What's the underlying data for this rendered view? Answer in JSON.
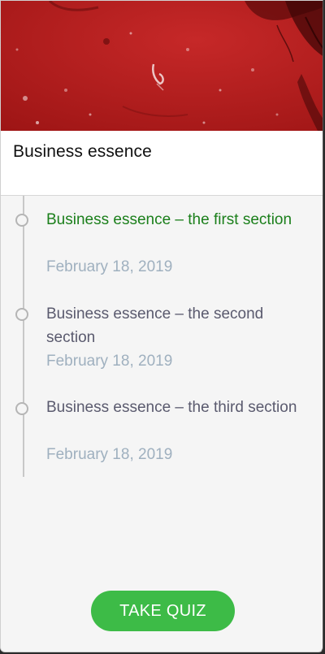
{
  "course": {
    "title": "Business essence"
  },
  "timeline": {
    "items": [
      {
        "title": "Business essence – the first section",
        "date": "February 18, 2019",
        "active": true
      },
      {
        "title": "Business essence – the second section",
        "date": "February 18, 2019",
        "active": false
      },
      {
        "title": "Business essence – the third section",
        "date": "February 18, 2019",
        "active": false
      }
    ]
  },
  "actions": {
    "take_quiz_label": "TAKE QUIZ"
  },
  "colors": {
    "hero_red": "#b71c1c",
    "active_title": "#1b7f1b",
    "inactive_title": "#5a5a6e",
    "date": "#9fb0bf",
    "button_green": "#3dbb47"
  },
  "icons": {
    "timeline_marker": "circle-outline-icon",
    "hero": "cover-image"
  }
}
